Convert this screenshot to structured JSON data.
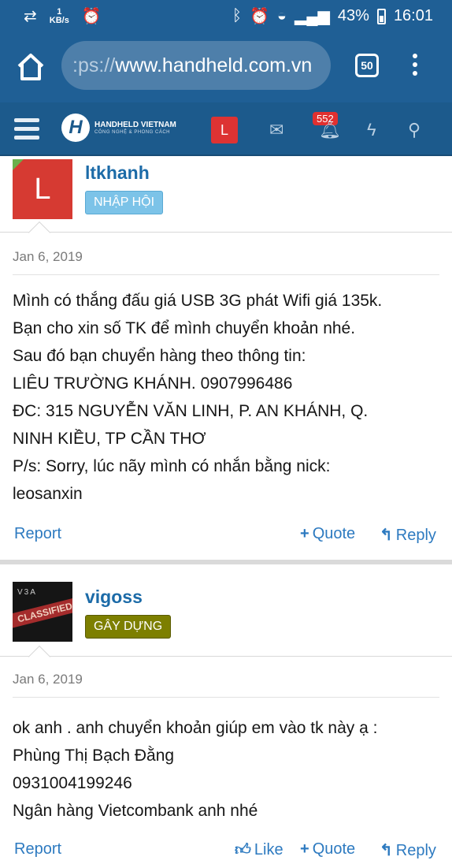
{
  "status": {
    "speed_value": "1",
    "speed_unit": "KB/s",
    "battery": "43%",
    "time": "16:01"
  },
  "browser": {
    "url_proto": ":ps://",
    "url_host": "www.handheld.com.vn",
    "tab_count": "50"
  },
  "nav": {
    "logo_letter": "H",
    "logo_title": "HANDHELD VIETNAM",
    "logo_subtitle": "CÔNG NGHỆ & PHONG CÁCH",
    "avatar_letter": "L",
    "alerts_badge": "552"
  },
  "posts": [
    {
      "avatar_letter": "L",
      "username": "ltkhanh",
      "role": "NHẬP HỘI",
      "date": "Jan 6, 2019",
      "lines": [
        "Mình có thắng đấu giá USB 3G phát Wifi giá 135k.",
        "Bạn cho xin số TK để mình chuyển khoản nhé.",
        "Sau đó bạn chuyển hàng theo thông tin:",
        "LIÊU TRƯỜNG KHÁNH. 0907996486",
        "ĐC: 315 NGUYỄN VĂN LINH, P. AN KHÁNH, Q.",
        "NINH KIỀU, TP CẦN THƠ",
        "P/s: Sorry, lúc nãy mình có nhắn bằng nick:",
        "leosanxin"
      ],
      "actions": {
        "report": "Report",
        "quote": "Quote",
        "reply": "Reply"
      }
    },
    {
      "avatar_text_top": "V3A",
      "avatar_text_band": "CLASSIFIED",
      "username": "vigoss",
      "role": "GÂY DỰNG",
      "date": "Jan 6, 2019",
      "lines": [
        "ok anh . anh chuyển khoản giúp em vào tk này ạ :",
        "Phùng Thị Bạch Đằng",
        "0931004199246",
        "Ngân hàng Vietcombank anh nhé"
      ],
      "actions": {
        "report": "Report",
        "like": "Like",
        "quote": "Quote",
        "reply": "Reply"
      }
    }
  ],
  "colors": {
    "top_bar": "#1f5f95",
    "nav_bar": "#1c5a8c",
    "link": "#2d7ac0",
    "username": "#1c6ba8",
    "avatar_red": "#d63a32",
    "role_join": "#7cc3e8",
    "role_build": "#7d7f00",
    "badge": "#e03030"
  }
}
